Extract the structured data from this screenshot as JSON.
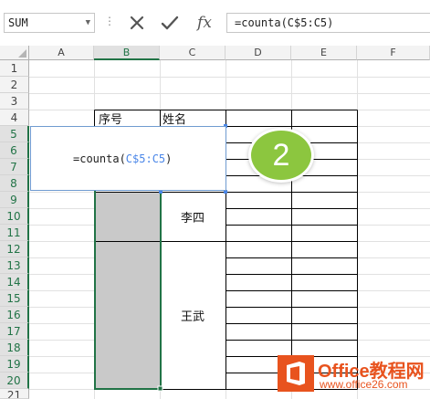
{
  "formula_bar": {
    "name_box": "SUM",
    "separator": "⋮",
    "cancel_icon": "✕",
    "enter_icon": "✓",
    "fx_label": "fx",
    "formula": "=counta(C$5:C5)"
  },
  "columns": [
    "A",
    "B",
    "C",
    "D",
    "E",
    "F"
  ],
  "rows": [
    "1",
    "2",
    "3",
    "4",
    "5",
    "6",
    "7",
    "8",
    "9",
    "10",
    "11",
    "12",
    "13",
    "14",
    "15",
    "16",
    "17",
    "18",
    "19",
    "20",
    "21"
  ],
  "selected_column": "B",
  "selected_rows": [
    "5",
    "6",
    "7",
    "8",
    "9",
    "10",
    "11",
    "12",
    "13",
    "14",
    "15",
    "16",
    "17",
    "18",
    "19",
    "20"
  ],
  "cells": {
    "b4": "序号",
    "c4": "姓名",
    "c10": "李四",
    "c16": "王武"
  },
  "edit_popup": {
    "prefix": "=counta(",
    "reference": "C$5:C5",
    "suffix": ")"
  },
  "step_badge": "2",
  "watermark": {
    "title": "Office教程网",
    "url": "www.office26.com"
  },
  "colors": {
    "excel_green": "#217346",
    "reference_blue": "#4a86e8",
    "badge_green": "#8cc63f",
    "watermark_orange": "#e8531e",
    "merged_gray": "#c9c9c9"
  }
}
